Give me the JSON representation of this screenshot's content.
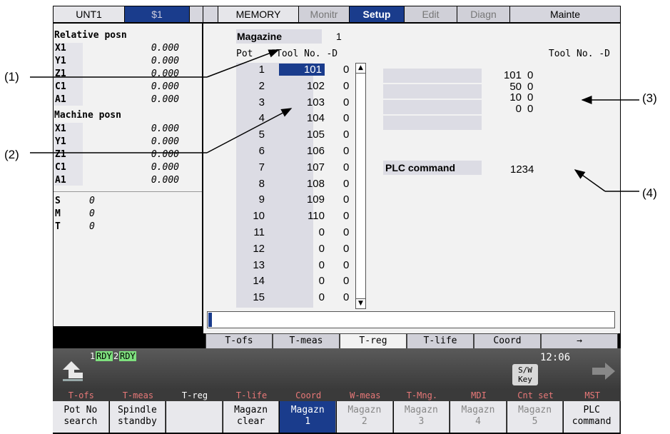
{
  "header": {
    "unit": "UNT1",
    "system": "$1",
    "mode": "MEMORY",
    "tabs": [
      {
        "label": "Monitr",
        "state": "dim"
      },
      {
        "label": "Setup",
        "state": "active"
      },
      {
        "label": "Edit",
        "state": "dim"
      },
      {
        "label": "Diagn",
        "state": "dim"
      },
      {
        "label": "Mainte",
        "state": "normal"
      }
    ]
  },
  "left": {
    "relative_title": "Relative posn",
    "relative": [
      {
        "axis": "X1",
        "value": "0.000"
      },
      {
        "axis": "Y1",
        "value": "0.000"
      },
      {
        "axis": "Z1",
        "value": "0.000"
      },
      {
        "axis": "C1",
        "value": "0.000"
      },
      {
        "axis": "A1",
        "value": "0.000"
      }
    ],
    "machine_title": "Machine posn",
    "machine": [
      {
        "axis": "X1",
        "value": "0.000"
      },
      {
        "axis": "Y1",
        "value": "0.000"
      },
      {
        "axis": "Z1",
        "value": "0.000"
      },
      {
        "axis": "C1",
        "value": "0.000"
      },
      {
        "axis": "A1",
        "value": "0.000"
      }
    ],
    "smt": [
      {
        "label": "S",
        "value": "0"
      },
      {
        "label": "M",
        "value": "0"
      },
      {
        "label": "T",
        "value": "0"
      }
    ]
  },
  "magazine": {
    "label": "Magazine",
    "number": "1",
    "col_pot": "Pot",
    "col_tool": "Tool No. -D",
    "pots": [
      {
        "pot": "1",
        "tool": "101",
        "d": "0"
      },
      {
        "pot": "2",
        "tool": "102",
        "d": "0"
      },
      {
        "pot": "3",
        "tool": "103",
        "d": "0"
      },
      {
        "pot": "4",
        "tool": "104",
        "d": "0"
      },
      {
        "pot": "5",
        "tool": "105",
        "d": "0"
      },
      {
        "pot": "6",
        "tool": "106",
        "d": "0"
      },
      {
        "pot": "7",
        "tool": "107",
        "d": "0"
      },
      {
        "pot": "8",
        "tool": "108",
        "d": "0"
      },
      {
        "pot": "9",
        "tool": "109",
        "d": "0"
      },
      {
        "pot": "10",
        "tool": "110",
        "d": "0"
      },
      {
        "pot": "11",
        "tool": "0",
        "d": "0"
      },
      {
        "pot": "12",
        "tool": "0",
        "d": "0"
      },
      {
        "pot": "13",
        "tool": "0",
        "d": "0"
      },
      {
        "pot": "14",
        "tool": "0",
        "d": "0"
      },
      {
        "pot": "15",
        "tool": "0",
        "d": "0"
      }
    ]
  },
  "spindle": {
    "col_tool": "Tool No. -D",
    "rows": [
      {
        "tool": "101",
        "d": "0"
      },
      {
        "tool": "50",
        "d": "0"
      },
      {
        "tool": "10",
        "d": "0"
      },
      {
        "tool": "0",
        "d": "0"
      }
    ]
  },
  "plc": {
    "label": "PLC command",
    "value": "1234"
  },
  "bottom_tabs": [
    "T-ofs",
    "T-meas",
    "T-reg",
    "T-life",
    "Coord",
    "→"
  ],
  "status": {
    "rdy1_num": "1",
    "rdy1": "RDY",
    "rdy2_num": "2",
    "rdy2": "RDY",
    "sw_key": "S/W Key",
    "time": "12:06"
  },
  "menu_top": [
    {
      "label": "T-ofs",
      "color": "#e87878"
    },
    {
      "label": "T-meas",
      "color": "#e87878"
    },
    {
      "label": "T-reg",
      "color": "#ffffff"
    },
    {
      "label": "T-life",
      "color": "#e87878"
    },
    {
      "label": "Coord",
      "color": "#e87878"
    },
    {
      "label": "W-meas",
      "color": "#e87878"
    },
    {
      "label": "T-Mng.",
      "color": "#e87878"
    },
    {
      "label": "MDI",
      "color": "#e87878"
    },
    {
      "label": "Cnt set",
      "color": "#e87878"
    },
    {
      "label": "MST",
      "color": "#e87878"
    }
  ],
  "softkeys": [
    {
      "line1": "Pot No",
      "line2": "search",
      "state": "normal"
    },
    {
      "line1": "Spindle",
      "line2": "standby",
      "state": "normal"
    },
    {
      "line1": "",
      "line2": "",
      "state": "normal"
    },
    {
      "line1": "Magazn",
      "line2": "clear",
      "state": "normal"
    },
    {
      "line1": "Magazn",
      "line2": "1",
      "state": "active"
    },
    {
      "line1": "Magazn",
      "line2": "2",
      "state": "dim"
    },
    {
      "line1": "Magazn",
      "line2": "3",
      "state": "dim"
    },
    {
      "line1": "Magazn",
      "line2": "4",
      "state": "dim"
    },
    {
      "line1": "Magazn",
      "line2": "5",
      "state": "dim"
    },
    {
      "line1": "PLC",
      "line2": "command",
      "state": "normal"
    }
  ],
  "callouts": [
    "(1)",
    "(2)",
    "(3)",
    "(4)"
  ],
  "colors": {
    "active": "#1a3c8c",
    "rdy": "#7ee07e",
    "menu_red": "#e87878"
  }
}
